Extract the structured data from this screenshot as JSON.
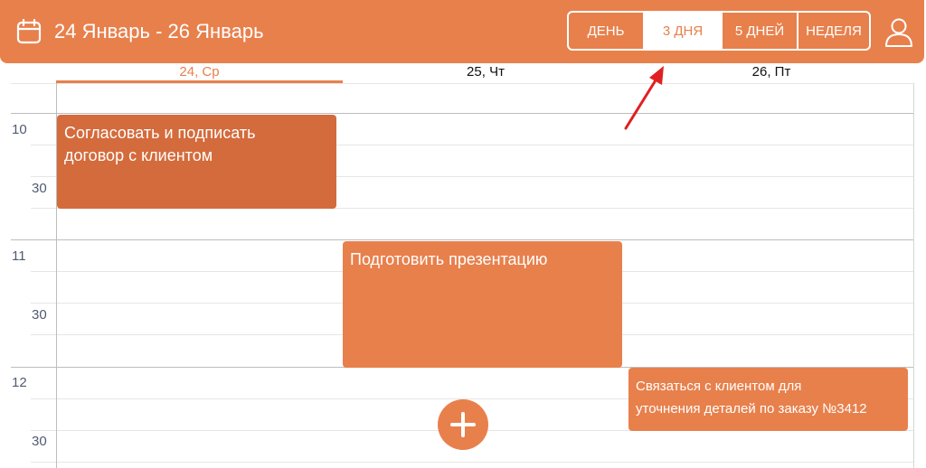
{
  "header": {
    "date_range": "24 Январь - 26 Январь",
    "calendar_icon": "calendar-icon",
    "user_icon": "user-icon",
    "accent_color": "#e8804c",
    "views": [
      "ДЕНЬ",
      "3 ДНЯ",
      "5 ДНЕЙ",
      "НЕДЕЛЯ"
    ],
    "active_view": "3 ДНЯ"
  },
  "days": [
    {
      "label": "24, Ср",
      "is_today": true
    },
    {
      "label": "25, Чт",
      "is_today": false
    },
    {
      "label": "26, Пт",
      "is_today": false
    }
  ],
  "time_labels": [
    "10",
    "30",
    "11",
    "30",
    "12",
    "30"
  ],
  "events": [
    {
      "title": "Согласовать и подписать\nдоговор с клиентом",
      "day": "24, Ср",
      "start": "10:00",
      "end": "10:45",
      "color": "#d46b3c"
    },
    {
      "title": "Подготовить презентацию",
      "day": "25, Чт",
      "start": "11:00",
      "end": "12:00",
      "color": "#e8804c"
    },
    {
      "title": "Связаться с клиентом для\nуточнения деталей по заказу №3412",
      "day": "26, Пт",
      "start": "12:00",
      "end": "12:30",
      "color": "#e8804c"
    }
  ],
  "add_button": {
    "icon": "plus-icon"
  },
  "annotation": {
    "icon": "red-arrow-icon",
    "color": "#e02020"
  }
}
